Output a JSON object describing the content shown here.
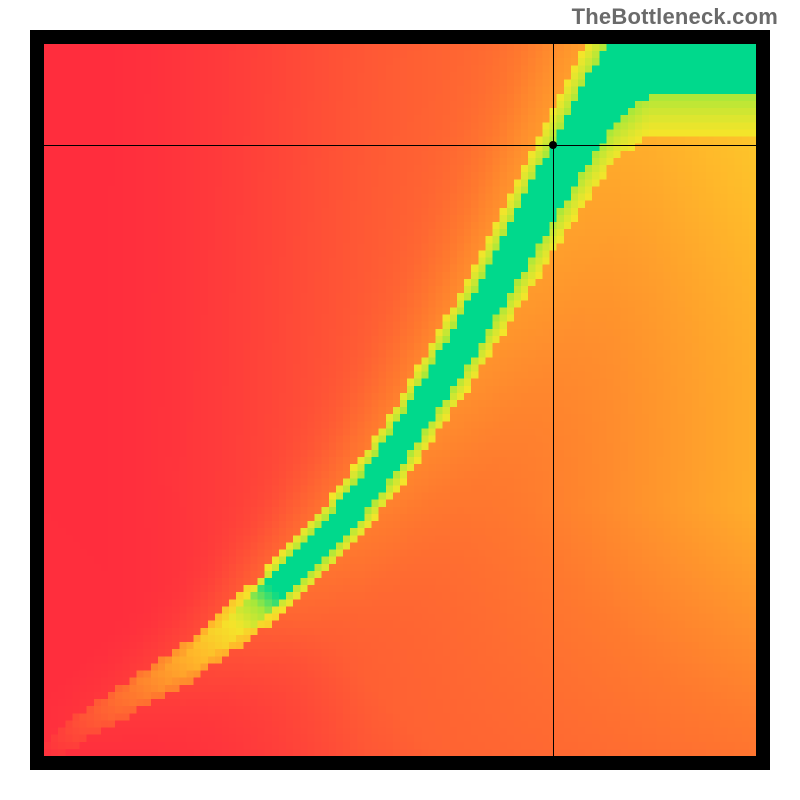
{
  "watermark": "TheBottleneck.com",
  "chart_data": {
    "type": "heatmap",
    "title": "",
    "xlabel": "",
    "ylabel": "",
    "xlim": [
      0,
      1
    ],
    "ylim": [
      0,
      1
    ],
    "grid_size": 100,
    "color_stops": [
      {
        "t": 0.0,
        "color": "#ff2a3e"
      },
      {
        "t": 0.4,
        "color": "#ff7a2e"
      },
      {
        "t": 0.65,
        "color": "#ffb92a"
      },
      {
        "t": 0.82,
        "color": "#f4e52a"
      },
      {
        "t": 0.92,
        "color": "#a8e83a"
      },
      {
        "t": 1.0,
        "color": "#00d98c"
      }
    ],
    "ridge": [
      {
        "x": 0.0,
        "y": 0.0
      },
      {
        "x": 0.05,
        "y": 0.04
      },
      {
        "x": 0.1,
        "y": 0.07
      },
      {
        "x": 0.15,
        "y": 0.1
      },
      {
        "x": 0.2,
        "y": 0.13
      },
      {
        "x": 0.25,
        "y": 0.17
      },
      {
        "x": 0.3,
        "y": 0.21
      },
      {
        "x": 0.35,
        "y": 0.26
      },
      {
        "x": 0.4,
        "y": 0.31
      },
      {
        "x": 0.45,
        "y": 0.37
      },
      {
        "x": 0.5,
        "y": 0.44
      },
      {
        "x": 0.55,
        "y": 0.52
      },
      {
        "x": 0.6,
        "y": 0.6
      },
      {
        "x": 0.65,
        "y": 0.69
      },
      {
        "x": 0.7,
        "y": 0.78
      },
      {
        "x": 0.75,
        "y": 0.87
      },
      {
        "x": 0.8,
        "y": 0.95
      },
      {
        "x": 0.85,
        "y": 1.0
      }
    ],
    "ridge_half_width": [
      {
        "x": 0.0,
        "w": 0.01
      },
      {
        "x": 0.1,
        "w": 0.012
      },
      {
        "x": 0.2,
        "w": 0.015
      },
      {
        "x": 0.3,
        "w": 0.02
      },
      {
        "x": 0.4,
        "w": 0.025
      },
      {
        "x": 0.5,
        "w": 0.032
      },
      {
        "x": 0.6,
        "w": 0.04
      },
      {
        "x": 0.7,
        "w": 0.05
      },
      {
        "x": 0.8,
        "w": 0.06
      },
      {
        "x": 0.85,
        "w": 0.065
      }
    ],
    "crosshair": {
      "x": 0.715,
      "y": 0.858
    }
  }
}
